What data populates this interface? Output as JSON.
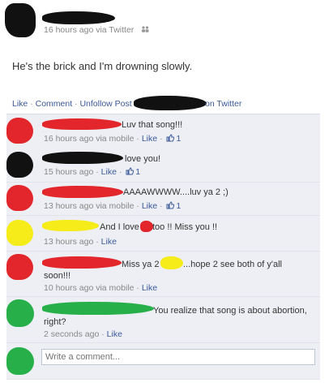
{
  "post": {
    "meta": "16 hours ago via Twitter",
    "text": "He's the brick and I'm drowning slowly."
  },
  "actions": {
    "like": "Like",
    "comment": "Comment",
    "unfollow": "Unfollow Post",
    "twitter_suffix": "on Twitter"
  },
  "comments": [
    {
      "text": "Luv that song!!!",
      "time": "16 hours ago via mobile",
      "like": "Like",
      "likes": "1"
    },
    {
      "text": "love you!",
      "time": "15 hours ago",
      "like": "Like",
      "likes": "1"
    },
    {
      "text": "AAAAWWWW....luv ya 2 ;)",
      "time": "13 hours ago via mobile",
      "like": "Like",
      "likes": "1"
    },
    {
      "text_a": "And I love",
      "text_b": "too !! Miss you !!",
      "time": "13 hours ago",
      "like": "Like"
    },
    {
      "text_a": "Miss ya 2",
      "text_b": "...hope 2 see both of y'all",
      "text_c": "soon!!!",
      "time": "10 hours ago via mobile",
      "like": "Like"
    },
    {
      "text_a": "You realize that song is about abortion,",
      "text_b": "right?",
      "time": "2 seconds ago",
      "like": "Like"
    }
  ],
  "composer": {
    "placeholder": "Write a comment..."
  },
  "colors": {
    "link": "#3b5998",
    "comment_bg": "#edeff4",
    "redact_red": "#e3262b",
    "redact_black": "#111111",
    "redact_yellow": "#f5ec1a",
    "redact_green": "#27b04a"
  }
}
